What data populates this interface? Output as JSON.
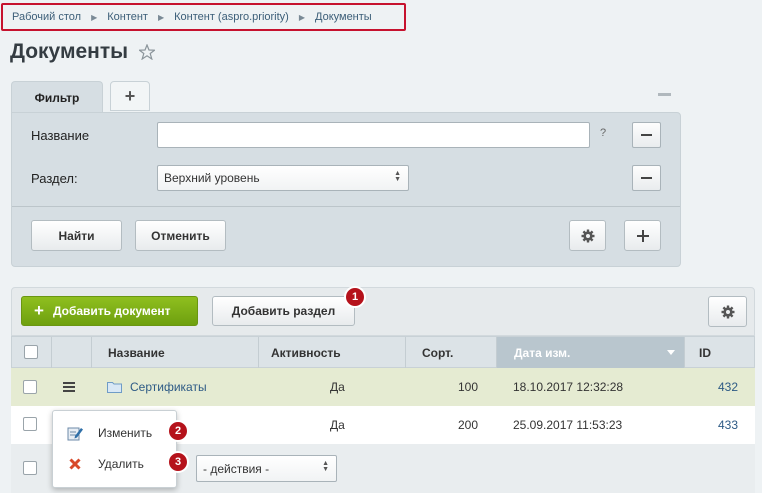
{
  "breadcrumb": {
    "items": [
      "Рабочий стол",
      "Контент",
      "Контент (aspro.priority)",
      "Документы"
    ],
    "separator": "▶"
  },
  "page": {
    "title": "Документы"
  },
  "filter": {
    "tab_label": "Фильтр",
    "add_tab_label": "+",
    "fields": [
      {
        "label": "Название",
        "value": "",
        "help": "?"
      },
      {
        "label": "Раздел:",
        "value": "Верхний уровень"
      }
    ],
    "find_label": "Найти",
    "cancel_label": "Отменить"
  },
  "toolbar": {
    "add_document_label": "Добавить документ",
    "add_section_label": "Добавить раздел"
  },
  "table": {
    "columns": [
      "Название",
      "Активность",
      "Сорт.",
      "Дата изм.",
      "ID"
    ],
    "sorted_column": "Дата изм.",
    "rows": [
      {
        "name": "Сертификаты",
        "active": "Да",
        "sort": "100",
        "date": "18.10.2017 12:32:28",
        "id": "432",
        "type": "folder"
      },
      {
        "name": "",
        "active": "Да",
        "sort": "200",
        "date": "25.09.2017 11:53:23",
        "id": "433",
        "type": "item"
      }
    ]
  },
  "context_menu": {
    "items": [
      {
        "label": "Изменить",
        "icon": "edit-icon"
      },
      {
        "label": "Удалить",
        "icon": "delete-icon"
      }
    ]
  },
  "footer": {
    "actions_placeholder": "- действия -"
  },
  "badges": [
    "1",
    "2",
    "3"
  ],
  "colors": {
    "accent_green": "#7aab17",
    "badge_red": "#b5121b",
    "link_blue": "#2d5a85",
    "highlight_red": "#c6122e"
  }
}
